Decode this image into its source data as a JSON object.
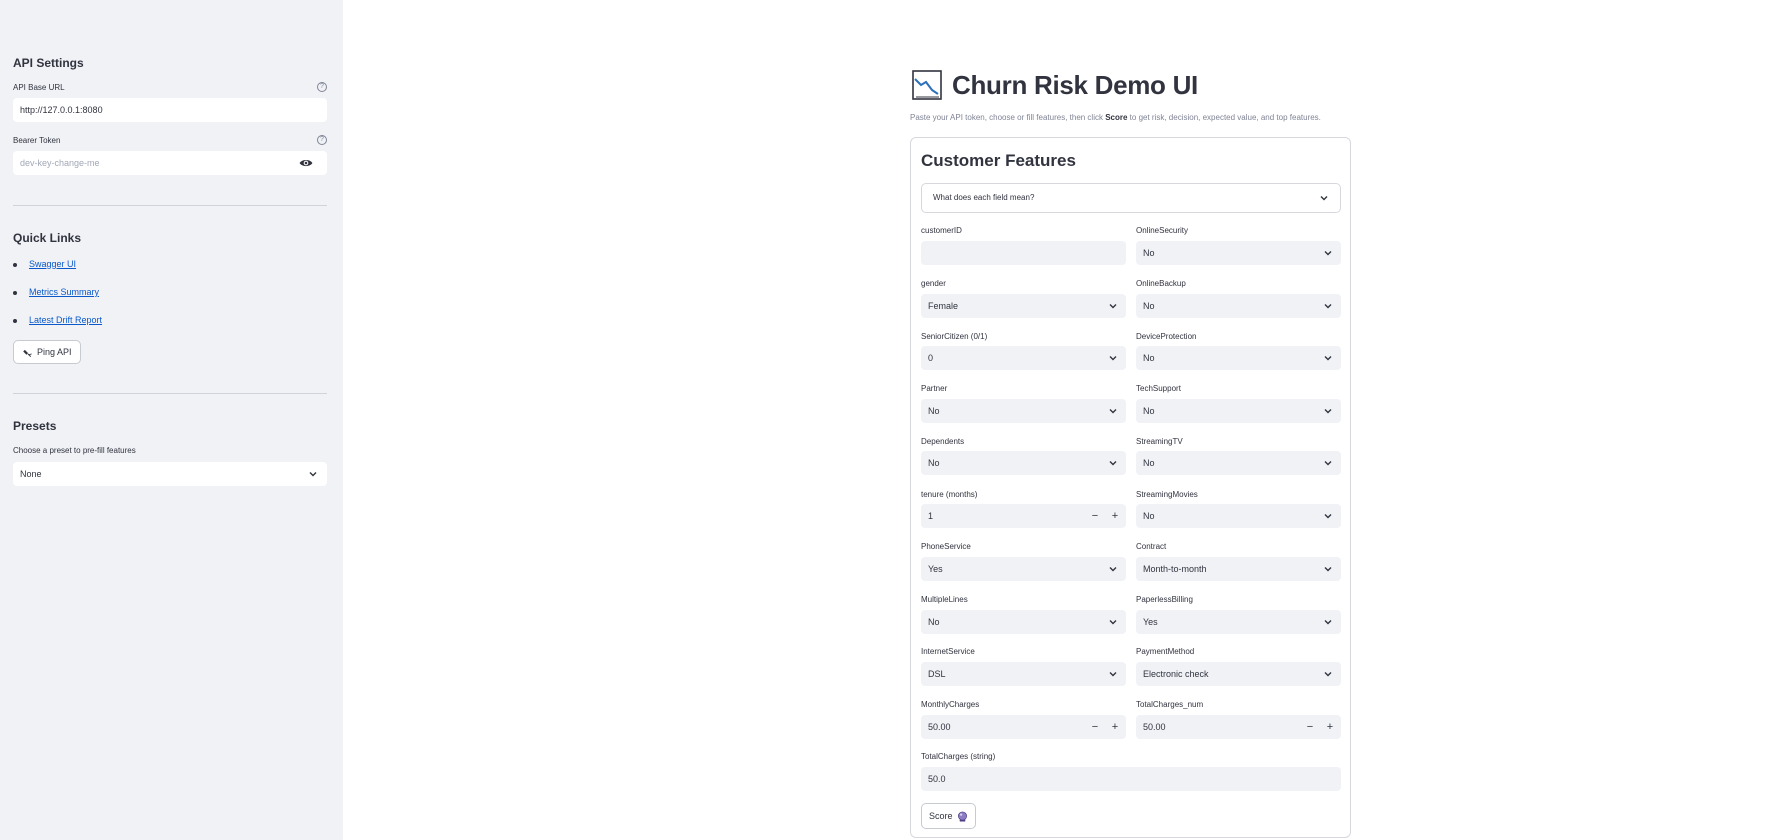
{
  "sidebar": {
    "api_settings_title": "API Settings",
    "api_base_url_label": "API Base URL",
    "api_base_url_value": "http://127.0.0.1:8080",
    "bearer_token_label": "Bearer Token",
    "bearer_token_placeholder": "dev-key-change-me",
    "quick_links_title": "Quick Links",
    "links": [
      "Swagger UI",
      "Metrics Summary",
      "Latest Drift Report"
    ],
    "ping_label": "Ping API",
    "presets_title": "Presets",
    "preset_label": "Choose a preset to pre-fill features",
    "preset_value": "None",
    "help_glyph": "?"
  },
  "main": {
    "title": "Churn Risk Demo UI",
    "caption_pre": "Paste your API token, choose or fill features, then click ",
    "caption_bold": "Score",
    "caption_post": " to get risk, decision, expected value, and top features.",
    "form_title": "Customer Features",
    "expander_label": "What does each field mean?",
    "score_label": "Score",
    "step_minus": "−",
    "step_plus": "+"
  },
  "fields": {
    "customerID": {
      "label": "customerID",
      "value": ""
    },
    "gender": {
      "label": "gender",
      "value": "Female"
    },
    "SeniorCitizen": {
      "label": "SeniorCitizen (0/1)",
      "value": "0"
    },
    "Partner": {
      "label": "Partner",
      "value": "No"
    },
    "Dependents": {
      "label": "Dependents",
      "value": "No"
    },
    "tenure": {
      "label": "tenure (months)",
      "value": "1"
    },
    "PhoneService": {
      "label": "PhoneService",
      "value": "Yes"
    },
    "MultipleLines": {
      "label": "MultipleLines",
      "value": "No"
    },
    "InternetService": {
      "label": "InternetService",
      "value": "DSL"
    },
    "MonthlyCharges": {
      "label": "MonthlyCharges",
      "value": "50.00"
    },
    "TotalChargesString": {
      "label": "TotalCharges (string)",
      "value": "50.0"
    },
    "OnlineSecurity": {
      "label": "OnlineSecurity",
      "value": "No"
    },
    "OnlineBackup": {
      "label": "OnlineBackup",
      "value": "No"
    },
    "DeviceProtection": {
      "label": "DeviceProtection",
      "value": "No"
    },
    "TechSupport": {
      "label": "TechSupport",
      "value": "No"
    },
    "StreamingTV": {
      "label": "StreamingTV",
      "value": "No"
    },
    "StreamingMovies": {
      "label": "StreamingMovies",
      "value": "No"
    },
    "Contract": {
      "label": "Contract",
      "value": "Month-to-month"
    },
    "PaperlessBilling": {
      "label": "PaperlessBilling",
      "value": "Yes"
    },
    "PaymentMethod": {
      "label": "PaymentMethod",
      "value": "Electronic check"
    },
    "TotalChargesNum": {
      "label": "TotalCharges_num",
      "value": "50.00"
    }
  },
  "icons": {
    "help": "help-circle-icon",
    "eye": "eye-icon",
    "chevron": "chevron-down-icon",
    "chart": "chart-decreasing-icon",
    "ping": "satellite-icon",
    "score": "crystal-ball-icon"
  },
  "colors": {
    "sidebar_bg": "#f0f2f6",
    "input_bg": "#f0f2f6",
    "link": "#0a58ca",
    "text": "#31333f"
  }
}
